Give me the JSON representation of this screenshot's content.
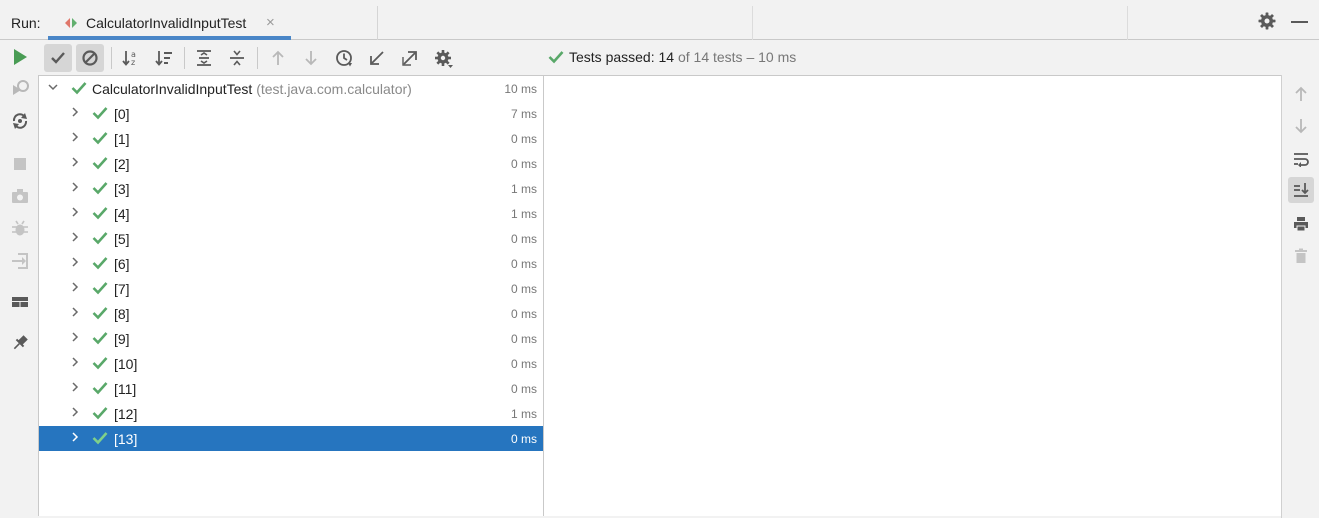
{
  "run_label": "Run:",
  "tab": {
    "title": "CalculatorInvalidInputTest",
    "close_symbol": "×",
    "icon": "test-class-icon"
  },
  "top_right": {
    "settings_icon": "gear-icon",
    "minimize_icon": "minimize-icon"
  },
  "left_actions": [
    "rerun-icon",
    "rerun-failed-icon",
    "toggle-auto-test-icon",
    "stop-icon",
    "screenshot-icon",
    "debug-icon",
    "exit-icon",
    "layout-icon",
    "pin-icon"
  ],
  "toolbar": {
    "buttons": [
      "show-passed-icon",
      "show-ignored-icon",
      "sort-alphabetically-icon",
      "sort-by-duration-icon",
      "expand-all-icon",
      "collapse-all-icon",
      "previous-failed-icon",
      "next-failed-icon",
      "test-history-icon",
      "import-tests-icon",
      "export-tests-icon",
      "settings-icon"
    ],
    "summary": {
      "label": "Tests passed:",
      "passed": "14",
      "of_text": "of 14 tests",
      "separator": "–",
      "duration": "10 ms"
    }
  },
  "tree": {
    "root": {
      "name": "CalculatorInvalidInputTest",
      "package": "(test.java.com.calculator)",
      "time": "10 ms"
    },
    "items": [
      {
        "name": "[0]",
        "time": "7 ms"
      },
      {
        "name": "[1]",
        "time": "0 ms"
      },
      {
        "name": "[2]",
        "time": "0 ms"
      },
      {
        "name": "[3]",
        "time": "1 ms"
      },
      {
        "name": "[4]",
        "time": "1 ms"
      },
      {
        "name": "[5]",
        "time": "0 ms"
      },
      {
        "name": "[6]",
        "time": "0 ms"
      },
      {
        "name": "[7]",
        "time": "0 ms"
      },
      {
        "name": "[8]",
        "time": "0 ms"
      },
      {
        "name": "[9]",
        "time": "0 ms"
      },
      {
        "name": "[10]",
        "time": "0 ms"
      },
      {
        "name": "[11]",
        "time": "0 ms"
      },
      {
        "name": "[12]",
        "time": "1 ms"
      },
      {
        "name": "[13]",
        "time": "0 ms"
      }
    ],
    "selected_index": 13
  },
  "right_actions": [
    "scroll-up-icon",
    "scroll-down-icon",
    "soft-wrap-icon",
    "scroll-to-end-icon",
    "print-icon",
    "clear-all-icon"
  ],
  "colors": {
    "accent": "#4a86c7",
    "selection": "#2675bf",
    "pass": "#59a869",
    "run": "#499c54"
  }
}
